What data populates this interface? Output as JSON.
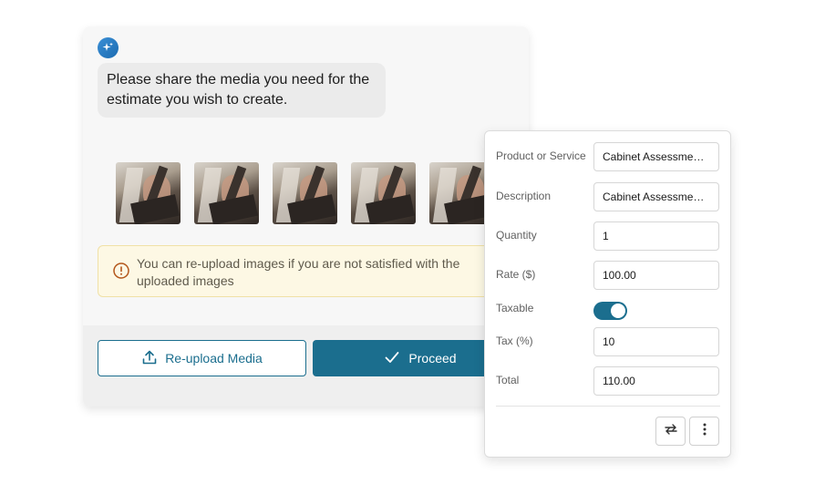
{
  "chat": {
    "message": "Please share the media you need for the estimate you wish to create.",
    "images": [
      "image-1",
      "image-2",
      "image-3",
      "image-4",
      "image-5"
    ],
    "notice": "You can re-upload images if you are not satisfied with the uploaded images",
    "reupload_label": "Re-upload Media",
    "proceed_label": "Proceed"
  },
  "form": {
    "product_label": "Product or Service",
    "product_value": "Cabinet Assessment…",
    "description_label": "Description",
    "description_value": "Cabinet Assessment…",
    "quantity_label": "Quantity",
    "quantity_value": "1",
    "rate_label": "Rate ($)",
    "rate_value": "100.00",
    "taxable_label": "Taxable",
    "taxable_on": true,
    "tax_label": "Tax (%)",
    "tax_value": "10",
    "total_label": "Total",
    "total_value": "110.00"
  },
  "colors": {
    "primary": "#1b6e8e",
    "notice_bg": "#fdf8e4",
    "notice_border": "#f0e1a6"
  }
}
